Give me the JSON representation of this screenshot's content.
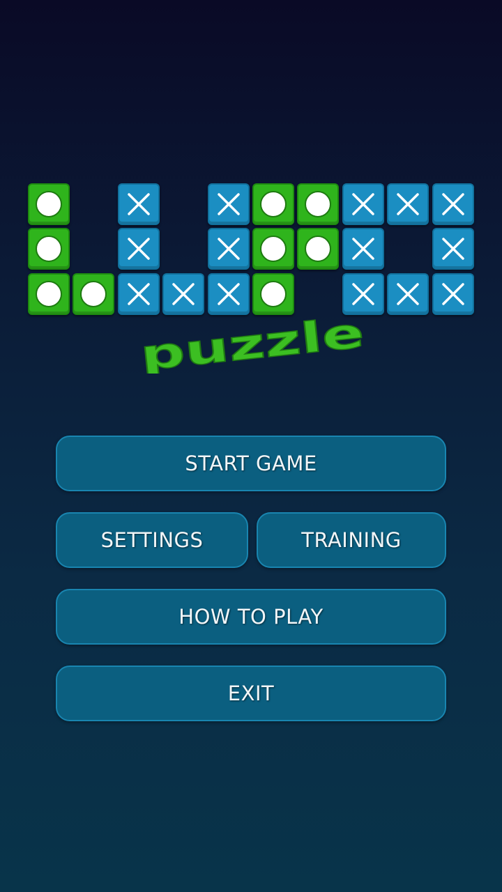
{
  "logo": {
    "subtitle": "puzzle",
    "tile_pattern": [
      "O.X.XOOXXX",
      "O.X.XOOX.X",
      "OOXXXO.XXX"
    ],
    "tile_icons": {
      "O": "circle-icon",
      "X": "cross-icon"
    },
    "colors": {
      "o_tile": "#2fb41c",
      "x_tile": "#1b8ec2",
      "subtitle": "#3cbf22"
    }
  },
  "menu": {
    "start_game": "START GAME",
    "settings": "SETTINGS",
    "training": "TRAINING",
    "how_to_play": "HOW TO PLAY",
    "exit": "EXIT"
  },
  "colors": {
    "background_top": "#0a0a26",
    "background_bottom": "#08344a",
    "button_fill": "#0b5f80",
    "button_border": "#1985b0"
  }
}
